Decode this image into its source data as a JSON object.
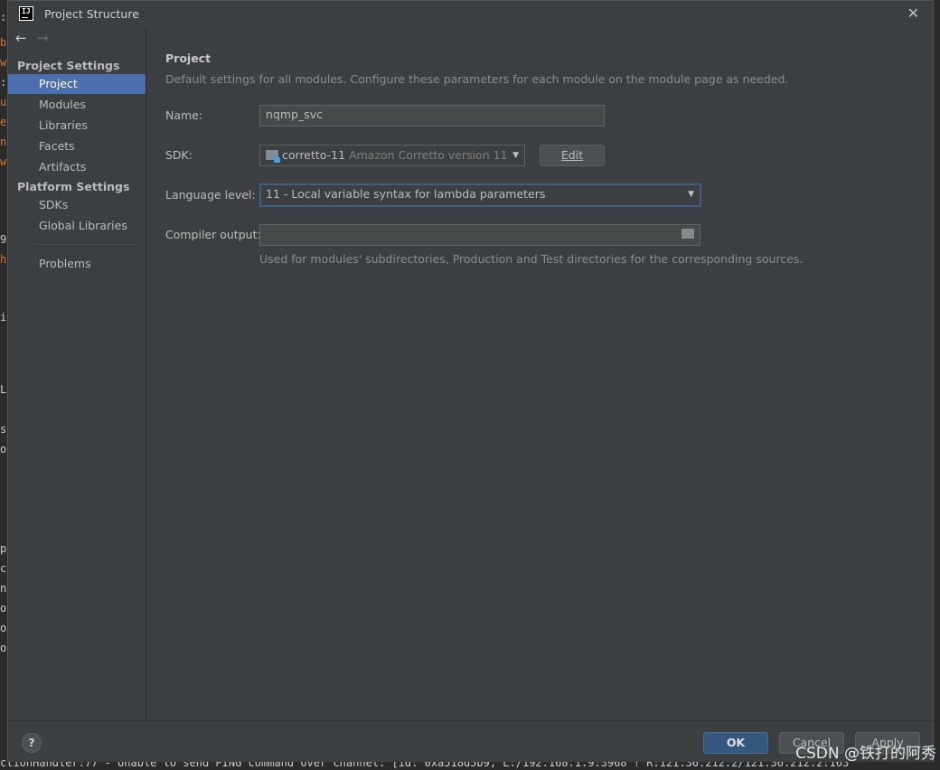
{
  "window": {
    "title": "Project Structure",
    "app_icon_text": "IJ"
  },
  "sidebar": {
    "back": "←",
    "forward": "→",
    "groups": [
      {
        "header": "Project Settings",
        "items": [
          "Project",
          "Modules",
          "Libraries",
          "Facets",
          "Artifacts"
        ]
      },
      {
        "header": "Platform Settings",
        "items": [
          "SDKs",
          "Global Libraries"
        ]
      }
    ],
    "problems": "Problems",
    "selected": "Project"
  },
  "content": {
    "title": "Project",
    "description": "Default settings for all modules. Configure these parameters for each module on the module page as needed.",
    "name_label": "Name:",
    "name_value": "nqmp_svc",
    "sdk_label": "SDK:",
    "sdk_name": "corretto-11",
    "sdk_detail": "Amazon Corretto version 11.0",
    "edit_button": "Edit",
    "language_level_label": "Language level:",
    "language_level_value": "11 - Local variable syntax for lambda parameters",
    "compiler_output_label": "Compiler output:",
    "compiler_output_value": "",
    "compiler_output_hint": "Used for modules' subdirectories, Production and Test directories for the corresponding sources."
  },
  "footer": {
    "help": "?",
    "ok": "OK",
    "cancel": "Cancel",
    "apply": "Apply"
  },
  "background": {
    "console_line": "ctionHandler:77 - Unable to send PING command over channel: [id: 0xa518d5b9, L:/192.168.1.9:3968 ! R:121.36.212.2/121.36.212.2:163"
  },
  "watermark": "CSDN @铁打的阿秀"
}
